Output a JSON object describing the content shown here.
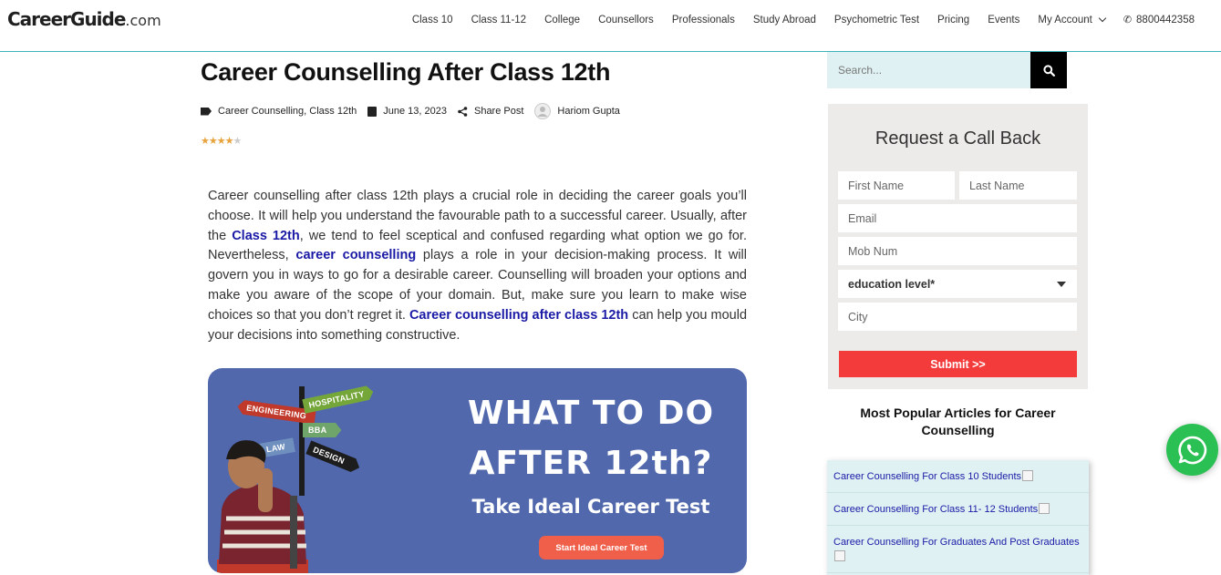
{
  "header": {
    "logo_main": "CareerGuide",
    "logo_suffix": ".com",
    "nav": [
      "Class 10",
      "Class 11-12",
      "College",
      "Counsellors",
      "Professionals",
      "Study Abroad",
      "Psychometric Test",
      "Pricing",
      "Events"
    ],
    "my_account": "My Account",
    "phone": "8800442358"
  },
  "article": {
    "title": "Career Counselling After Class 12th",
    "categories": "Career Counselling, Class 12th",
    "date": "June 13, 2023",
    "share": "Share Post",
    "author": "Hariom Gupta",
    "rating_stars": 4.5,
    "paragraph": {
      "p1": "Career counselling after class 12th plays a crucial role in deciding the career goals you’ll choose. It will help you understand the favourable path to a successful career. Usually, after the ",
      "link1": "Class 12th",
      "p2": ", we tend to feel sceptical and confused regarding what option we go for. Nevertheless, ",
      "link2": "career counselling",
      "p3": " plays a role in your decision-making process. It will govern you in ways to go for a desirable career. Counselling will broaden your options and make you aware of the scope of your domain. But, make sure you learn to make wise choices so that you don’t regret it. ",
      "link3": "Career counselling after class 12th",
      "p4": " can help you mould your decisions into something constructive."
    }
  },
  "banner": {
    "line1": "WHAT TO DO",
    "line2": "AFTER 12th?",
    "subtitle": "Take Ideal Career Test",
    "button": "Start Ideal Career Test",
    "signs": {
      "engineering": "ENGINEERING",
      "hospitality": "HOSPITALITY",
      "bba": "BBA",
      "law": "LAW",
      "design": "DESIGN"
    },
    "bg_color": "#5168ad"
  },
  "sidebar": {
    "search_placeholder": "Search...",
    "form": {
      "title": "Request a Call Back",
      "first_name": "First Name",
      "last_name": "Last Name",
      "email": "Email",
      "mobile": "Mob Num",
      "education": "education level*",
      "city": "City",
      "submit": "Submit >>"
    },
    "popular_title": "Most Popular Articles for Career Counselling",
    "popular": [
      "Career Counselling For Class 10 Students",
      "Career Counselling For Class 11- 12 Students",
      "Career Counselling For Graduates And Post Graduates"
    ]
  },
  "colors": {
    "accent_teal": "#3bb3b8",
    "submit_red": "#f33b3b",
    "link_blue": "#1a1aa6",
    "whatsapp_green": "#2bc054"
  }
}
